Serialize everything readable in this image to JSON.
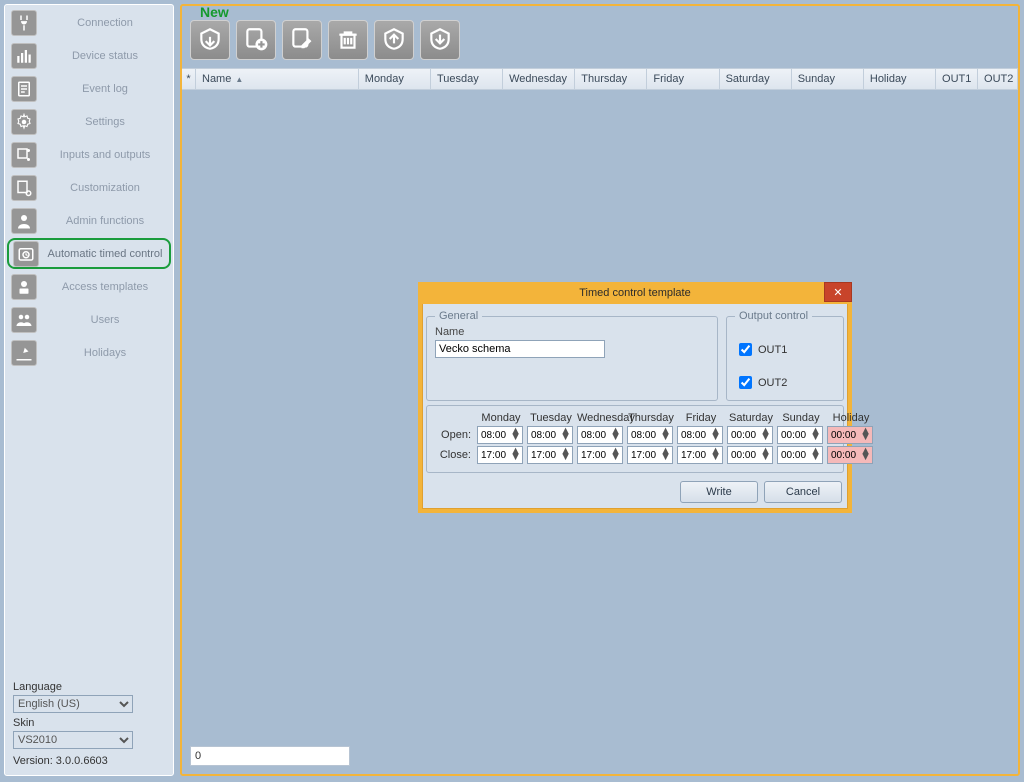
{
  "annotation": {
    "new": "New"
  },
  "sidebar": {
    "items": [
      {
        "id": "connection",
        "label": "Connection"
      },
      {
        "id": "device-status",
        "label": "Device status"
      },
      {
        "id": "event-log",
        "label": "Event log"
      },
      {
        "id": "settings",
        "label": "Settings"
      },
      {
        "id": "inputs-outputs",
        "label": "Inputs and outputs"
      },
      {
        "id": "customization",
        "label": "Customization"
      },
      {
        "id": "admin-functions",
        "label": "Admin functions"
      },
      {
        "id": "automatic-timed-control",
        "label": "Automatic timed control"
      },
      {
        "id": "access-templates",
        "label": "Access templates"
      },
      {
        "id": "users",
        "label": "Users"
      },
      {
        "id": "holidays",
        "label": "Holidays"
      }
    ],
    "activeIndex": 7,
    "language_label": "Language",
    "language_value": "English (US)",
    "skin_label": "Skin",
    "skin_value": "VS2010",
    "version_label": "Version: 3.0.0.6603"
  },
  "toolbar": {
    "buttons": [
      "read",
      "new",
      "edit",
      "delete",
      "import",
      "export"
    ]
  },
  "grid": {
    "columns": [
      "Name",
      "Monday",
      "Tuesday",
      "Wednesday",
      "Thursday",
      "Friday",
      "Saturday",
      "Sunday",
      "Holiday",
      "OUT1",
      "OUT2"
    ]
  },
  "status": {
    "value": "0"
  },
  "dialog": {
    "title": "Timed control template",
    "general_legend": "General",
    "name_label": "Name",
    "name_value": "Vecko schema",
    "output_legend": "Output control",
    "out1_label": "OUT1",
    "out2_label": "OUT2",
    "out1_checked": true,
    "out2_checked": true,
    "days": [
      "Monday",
      "Tuesday",
      "Wednesday",
      "Thursday",
      "Friday",
      "Saturday",
      "Sunday",
      "Holiday"
    ],
    "open_label": "Open:",
    "close_label": "Close:",
    "open": [
      "08:00",
      "08:00",
      "08:00",
      "08:00",
      "08:00",
      "00:00",
      "00:00",
      "00:00"
    ],
    "close": [
      "17:00",
      "17:00",
      "17:00",
      "17:00",
      "17:00",
      "00:00",
      "00:00",
      "00:00"
    ],
    "write_btn": "Write",
    "cancel_btn": "Cancel"
  }
}
